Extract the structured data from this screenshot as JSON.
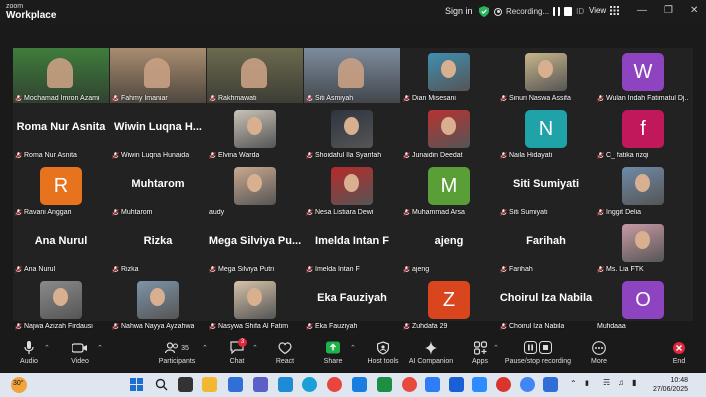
{
  "app": {
    "logo_top": "zoom",
    "logo_bottom": "Workplace",
    "sign_in": "Sign in",
    "recording": "Recording...",
    "record_id": "ID",
    "view": "View"
  },
  "tiles": [
    {
      "name": "Mochamad Imron Azami",
      "type": "video",
      "bg": "#3f7d3c"
    },
    {
      "name": "Fahmy Imaniar",
      "type": "video",
      "bg": "#a88d70"
    },
    {
      "name": "Rakhmawati",
      "type": "video",
      "bg": "#6b6a4e",
      "active": true
    },
    {
      "name": "Siti Asmiyah",
      "type": "video",
      "bg": "#7d8c9c"
    },
    {
      "name": "Dian Misesani",
      "type": "photo",
      "bg": "#3f8fb0"
    },
    {
      "name": "Sinuri Naswa Assifa",
      "type": "photo",
      "bg": "#c9b58a"
    },
    {
      "name": "Wulan Indah Fatimatul Dj...",
      "type": "avatar",
      "initial": "W",
      "bg": "#8e44c0"
    },
    {
      "name": "Roma Nur Asnita",
      "type": "name",
      "big": "Roma Nur Asnita"
    },
    {
      "name": "Wiwin Luqna Hunaida",
      "type": "name",
      "big": "Wiwin Luqna H..."
    },
    {
      "name": "Elvina Warda",
      "type": "photo",
      "bg": "#c9c2b8"
    },
    {
      "name": "Shoidaful Ila Syarifah",
      "type": "photo",
      "bg": "#2e3440"
    },
    {
      "name": "Junaidin Deedat",
      "type": "photo",
      "bg": "#b83232"
    },
    {
      "name": "Naila Hidayati",
      "type": "avatar",
      "initial": "N",
      "bg": "#1fa3a8"
    },
    {
      "name": "C_ fatika rizqi",
      "type": "avatar",
      "initial": "f",
      "bg": "#c0185a"
    },
    {
      "name": "Ravani Anggari",
      "type": "avatar",
      "initial": "R",
      "bg": "#e8731e"
    },
    {
      "name": "Muhtarom",
      "type": "name",
      "big": "Muhtarom"
    },
    {
      "name": "audy",
      "type": "photo",
      "bg": "#caa88e",
      "nomic": true
    },
    {
      "name": "Nesa Listiara Dewi",
      "type": "photo",
      "bg": "#b72a2a"
    },
    {
      "name": "Muhammad Arsa",
      "type": "avatar",
      "initial": "M",
      "bg": "#5a9e38"
    },
    {
      "name": "Siti Sumiyati",
      "type": "name",
      "big": "Siti Sumiyati"
    },
    {
      "name": "Inggit Delia",
      "type": "photo",
      "bg": "#6f8aa8"
    },
    {
      "name": "Ana Nurul",
      "type": "name",
      "big": "Ana Nurul"
    },
    {
      "name": "Rizka",
      "type": "name",
      "big": "Rizka"
    },
    {
      "name": "Mega Silviya Putri",
      "type": "name",
      "big": "Mega Silviya Pu..."
    },
    {
      "name": "Imelda Intan F",
      "type": "name",
      "big": "Imelda Intan F"
    },
    {
      "name": "ajeng",
      "type": "name",
      "big": "ajeng"
    },
    {
      "name": "Farihah",
      "type": "name",
      "big": "Farihah"
    },
    {
      "name": "Ms. Lia FTK",
      "type": "photo",
      "bg": "#c89aa4"
    },
    {
      "name": "Najwa Azizah Firdausi",
      "type": "photo",
      "bg": "#8a8a8a"
    },
    {
      "name": "Nahwa Nayya Ayzahwa",
      "type": "photo",
      "bg": "#7d94a8"
    },
    {
      "name": "Nasywa Shifa Al Fatim",
      "type": "photo",
      "bg": "#d6c2a8"
    },
    {
      "name": "Eka Fauziyah",
      "type": "name",
      "big": "Eka Fauziyah"
    },
    {
      "name": "Zuhdafa 29",
      "type": "avatar",
      "initial": "Z",
      "bg": "#d9461e"
    },
    {
      "name": "Choirul Iza Nabila",
      "type": "name",
      "big": "Choirul Iza Nabila"
    },
    {
      "name": "Mufidaaa",
      "type": "avatar",
      "initial": "O",
      "bg": "#8e44c0",
      "nomic": true
    }
  ],
  "toolbar": {
    "audio": "Audio",
    "video": "Video",
    "participants": "Participants",
    "participants_count": "35",
    "chat": "Chat",
    "chat_badge": "3",
    "react": "React",
    "share": "Share",
    "host_tools": "Host tools",
    "ai_companion": "AI Companion",
    "apps": "Apps",
    "pause_rec": "Pause/stop recording",
    "more": "More",
    "end": "End"
  },
  "taskbar": {
    "temp": "30°",
    "time": "10:48",
    "date": "27/06/2025"
  },
  "colors": {
    "active_border": "#2ab55a",
    "share_green": "#1fb24a",
    "end_red": "#e0263a"
  }
}
